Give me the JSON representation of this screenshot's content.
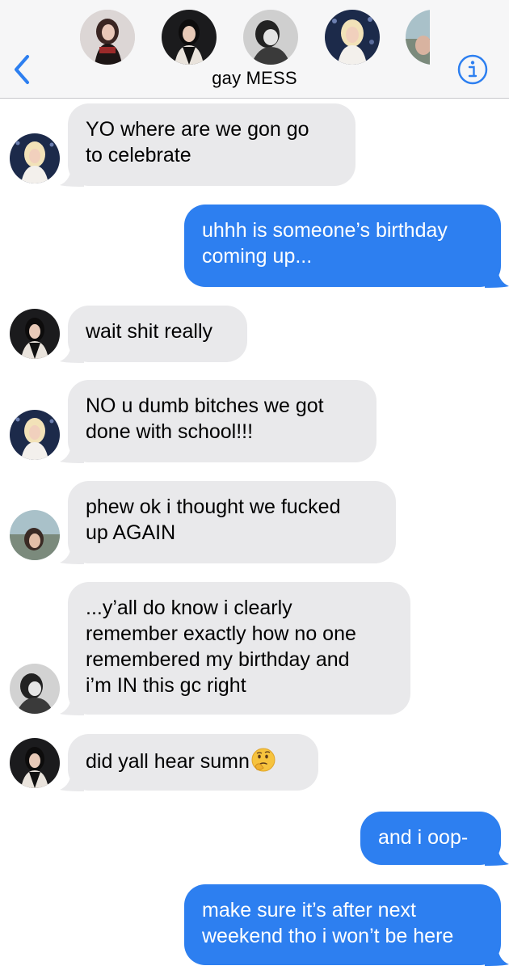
{
  "header": {
    "title": "gay MESS",
    "back_icon": "chevron-left-icon",
    "info_icon": "info-icon"
  },
  "colors": {
    "accent": "#2d7ff0",
    "incoming_bubble": "#e9e9eb",
    "header_bg": "#f6f6f7"
  },
  "messages": [
    {
      "direction": "incoming",
      "sender_avatar": "blonde-member",
      "lines": [
        "YO where are we gon go",
        "to celebrate"
      ]
    },
    {
      "direction": "outgoing",
      "lines": [
        "uhhh is someone’s birthday",
        "coming up..."
      ]
    },
    {
      "direction": "incoming",
      "sender_avatar": "dark-hair-member",
      "lines": [
        "wait shit really"
      ]
    },
    {
      "direction": "incoming",
      "sender_avatar": "blonde-member",
      "lines": [
        "NO u dumb bitches we got",
        "done with school!!!"
      ]
    },
    {
      "direction": "incoming",
      "sender_avatar": "outdoor-member",
      "lines": [
        "phew ok i thought we fucked",
        "up AGAIN"
      ]
    },
    {
      "direction": "incoming",
      "sender_avatar": "bw-member",
      "lines": [
        "...y’all do know i clearly",
        "remember exactly how no one",
        "remembered my birthday and",
        "i’m IN this gc right"
      ]
    },
    {
      "direction": "incoming",
      "sender_avatar": "dark-hair-member",
      "lines": [
        "did yall hear sumn"
      ],
      "emoji": "thinking-face-emoji"
    },
    {
      "direction": "outgoing",
      "lines": [
        "and i oop-"
      ]
    },
    {
      "direction": "outgoing",
      "lines": [
        "make sure it’s after next",
        "weekend tho i won’t be here"
      ]
    }
  ]
}
